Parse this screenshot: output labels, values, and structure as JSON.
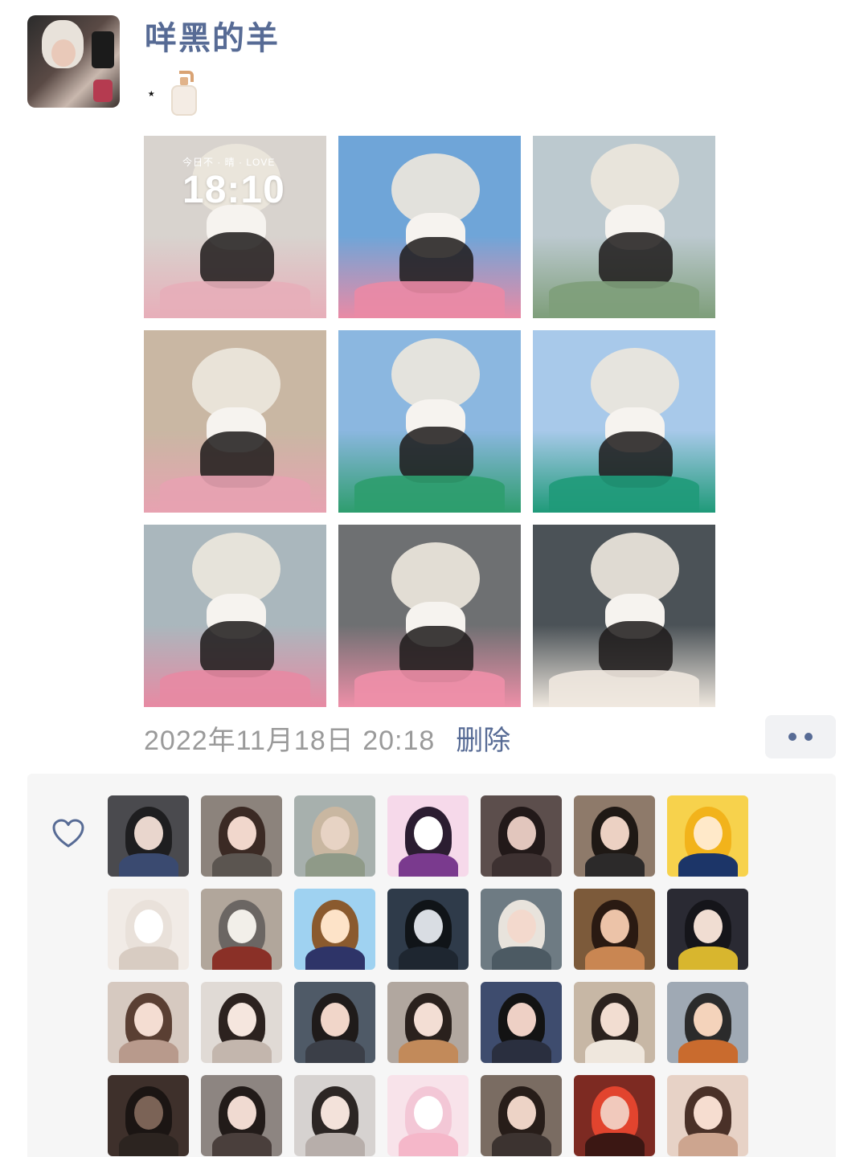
{
  "user": {
    "name": "咩黑的羊"
  },
  "post": {
    "text": "⋆",
    "emoji_icon": "lotion-bottle-icon",
    "photos": [
      {
        "name": "photo-lockscreen-selfie",
        "palette": [
          "#d8d3ce",
          "#e7aeb9"
        ],
        "lock_status": "今日不 · 晴 · LOVE",
        "lock_time": "18:10"
      },
      {
        "name": "photo-peace-sign-selfie",
        "palette": [
          "#6fa5d8",
          "#ea8aa5"
        ]
      },
      {
        "name": "photo-airport-walkway",
        "palette": [
          "#bcc9cf",
          "#7e9e7a"
        ]
      },
      {
        "name": "photo-train-selfie",
        "palette": [
          "#c9b7a3",
          "#e7a2b1"
        ]
      },
      {
        "name": "photo-car-peace-sign",
        "palette": [
          "#8bb7e0",
          "#2e9d6e"
        ]
      },
      {
        "name": "photo-green-barrier",
        "palette": [
          "#a8c9ea",
          "#1f9a79"
        ]
      },
      {
        "name": "photo-airport-back-view",
        "palette": [
          "#aab7bd",
          "#e78aa3"
        ]
      },
      {
        "name": "photo-escalator-outfit",
        "palette": [
          "#6e7072",
          "#ee8fa8"
        ]
      },
      {
        "name": "photo-mask-closeup",
        "palette": [
          "#4b5257",
          "#efe8df"
        ]
      }
    ],
    "timestamp": "2022年11月18日 20:18",
    "delete_label": "删除"
  },
  "likes": {
    "icon": "heart-outline-icon",
    "avatars": [
      {
        "name": "liker-avatar-1",
        "bg": "#4a4a4e",
        "hair": "#1e1e20",
        "face": "#e9d6cd",
        "body": "#3a4a70"
      },
      {
        "name": "liker-avatar-2",
        "bg": "#8c837c",
        "hair": "#3b2a24",
        "face": "#f1d7cc",
        "body": "#5b5550"
      },
      {
        "name": "liker-avatar-3",
        "bg": "#a7b0ad",
        "hair": "#c9b7a1",
        "face": "#e7d3c4",
        "body": "#8f9a88"
      },
      {
        "name": "liker-avatar-4",
        "bg": "#f6d9ea",
        "hair": "#2b1d31",
        "face": "#ffffff",
        "body": "#7a3a8e"
      },
      {
        "name": "liker-avatar-5",
        "bg": "#5c4e4c",
        "hair": "#221919",
        "face": "#e2c6bd",
        "body": "#3d3131"
      },
      {
        "name": "liker-avatar-6",
        "bg": "#8e7a6a",
        "hair": "#1f1915",
        "face": "#ecd1c3",
        "body": "#2c2a2a"
      },
      {
        "name": "liker-avatar-7",
        "bg": "#f7d24c",
        "hair": "#f2b31b",
        "face": "#ffe9c9",
        "body": "#1c3568"
      },
      {
        "name": "liker-avatar-8",
        "bg": "#f1ebe6",
        "hair": "#e9e1da",
        "face": "#ffffff",
        "body": "#d8ccc2"
      },
      {
        "name": "liker-avatar-9",
        "bg": "#b1a69b",
        "hair": "#6b6663",
        "face": "#f2efe9",
        "body": "#8a3027"
      },
      {
        "name": "liker-avatar-10",
        "bg": "#9fd2f1",
        "hair": "#8a5a2e",
        "face": "#fde3c8",
        "body": "#2e3468"
      },
      {
        "name": "liker-avatar-11",
        "bg": "#2f3b4a",
        "hair": "#101418",
        "face": "#d9dde3",
        "body": "#1e2630"
      },
      {
        "name": "liker-avatar-12",
        "bg": "#6e7b83",
        "hair": "#e8e3dc",
        "face": "#f3d9cd",
        "body": "#4c5a63"
      },
      {
        "name": "liker-avatar-13",
        "bg": "#7c5a3a",
        "hair": "#2a1a12",
        "face": "#ecc3a8",
        "body": "#c98652"
      },
      {
        "name": "liker-avatar-14",
        "bg": "#2a2a33",
        "hair": "#15151a",
        "face": "#f0ddd2",
        "body": "#d8b62e"
      },
      {
        "name": "liker-avatar-15",
        "bg": "#d6c9c0",
        "hair": "#5a3f33",
        "face": "#f4ddd2",
        "body": "#b89a8c"
      },
      {
        "name": "liker-avatar-16",
        "bg": "#e0dad5",
        "hair": "#2c221f",
        "face": "#f5e6de",
        "body": "#c3b6ad"
      },
      {
        "name": "liker-avatar-17",
        "bg": "#4f5a67",
        "hair": "#1f1b1a",
        "face": "#f1d6c9",
        "body": "#3b3f48"
      },
      {
        "name": "liker-avatar-18",
        "bg": "#b1a79f",
        "hair": "#2a211d",
        "face": "#f3ded4",
        "body": "#c28a5a"
      },
      {
        "name": "liker-avatar-19",
        "bg": "#3e4c6e",
        "hair": "#131313",
        "face": "#eed0c5",
        "body": "#2a2f3f"
      },
      {
        "name": "liker-avatar-20",
        "bg": "#c7b7a5",
        "hair": "#2b221e",
        "face": "#f2ddd1",
        "body": "#efe7dd"
      },
      {
        "name": "liker-avatar-21",
        "bg": "#9fa9b4",
        "hair": "#2b2b2b",
        "face": "#f4d3bb",
        "body": "#c96b2e"
      },
      {
        "name": "liker-avatar-22",
        "bg": "#3e302b",
        "hair": "#1b1513",
        "face": "#7b6356",
        "body": "#2c2420"
      },
      {
        "name": "liker-avatar-23",
        "bg": "#8d8581",
        "hair": "#221b19",
        "face": "#f0dad1",
        "body": "#4a3f3c"
      },
      {
        "name": "liker-avatar-24",
        "bg": "#d6d2d0",
        "hair": "#2c2624",
        "face": "#f3e2da",
        "body": "#b7aeaa"
      },
      {
        "name": "liker-avatar-25",
        "bg": "#f8e3ea",
        "hair": "#f3c7d6",
        "face": "#ffffff",
        "body": "#f5b7c9"
      },
      {
        "name": "liker-avatar-26",
        "bg": "#7a6c62",
        "hair": "#271d19",
        "face": "#edd3c6",
        "body": "#3c3330"
      },
      {
        "name": "liker-avatar-27",
        "bg": "#7d2a22",
        "hair": "#e2442e",
        "face": "#f1c9bc",
        "body": "#3b1713"
      },
      {
        "name": "liker-avatar-28",
        "bg": "#e7d2c6",
        "hair": "#4a3128",
        "face": "#f6ddd0",
        "body": "#cda58f"
      }
    ]
  },
  "colors": {
    "link": "#576b95",
    "timestamp": "#9a9a9a",
    "likes_bg": "#f6f6f6"
  }
}
